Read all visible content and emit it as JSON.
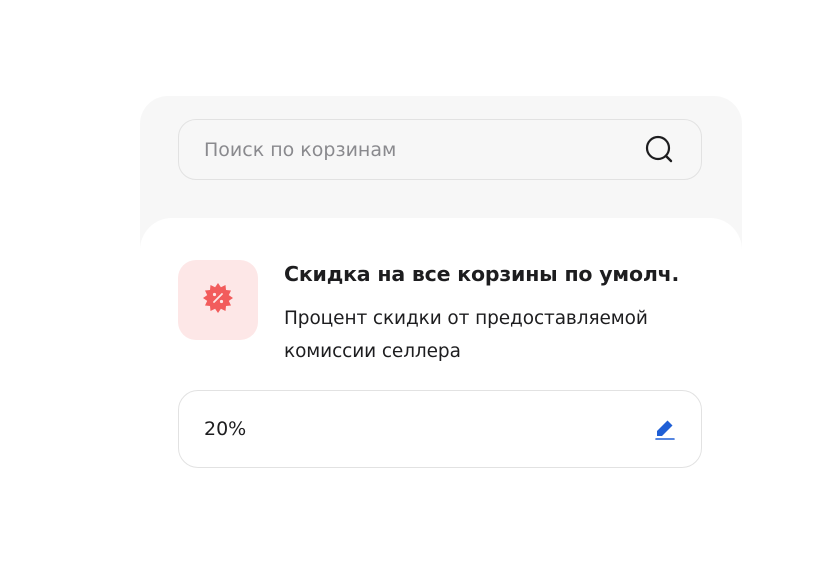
{
  "search": {
    "placeholder": "Поиск по корзинам",
    "icon": "search-icon"
  },
  "discount_setting": {
    "icon": "discount-badge-icon",
    "title": "Скидка на все корзины по умолч.",
    "description": "Процент скидки от предоставляемой комиссии селлера",
    "value": "20%",
    "edit_icon": "pencil-icon"
  },
  "colors": {
    "accent": "#1f5fd6",
    "icon_bg": "#fde7e7",
    "icon_fg": "#f25c5c",
    "panel_bg": "#f7f7f7",
    "border": "#e2e2e2",
    "text": "#1d1d1f",
    "placeholder": "#8a8a8e"
  }
}
